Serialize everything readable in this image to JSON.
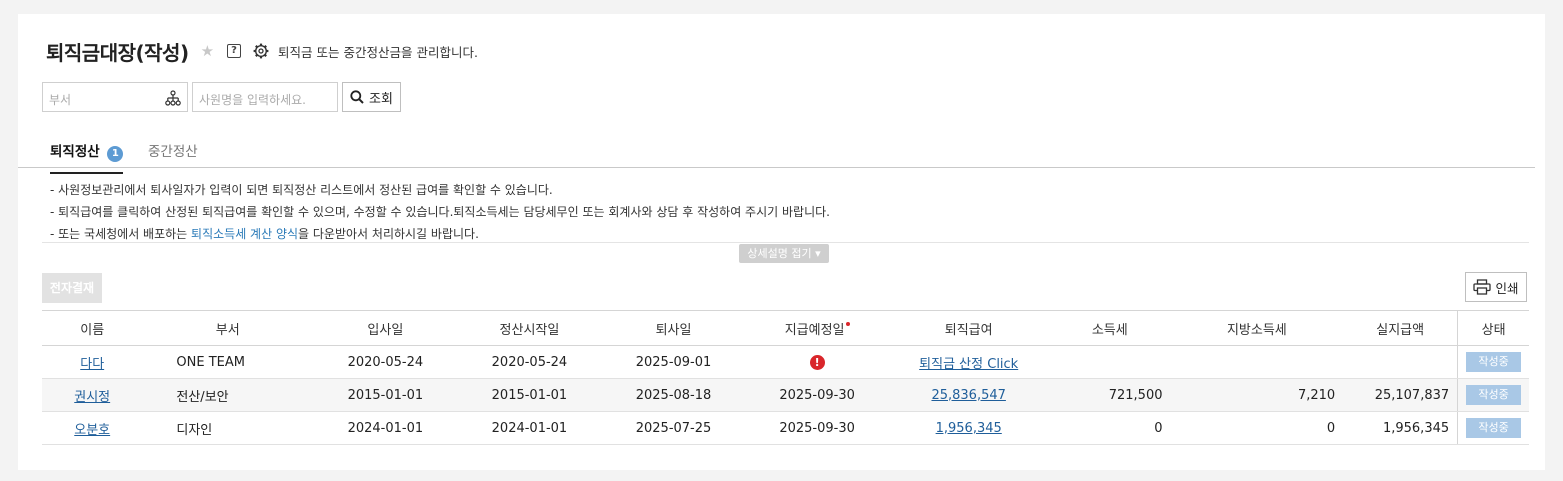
{
  "header": {
    "title": "퇴직금대장(작성)",
    "help_glyph": "?",
    "description": "퇴직금 또는 중간정산금을 관리합니다."
  },
  "search": {
    "dept_placeholder": "부서",
    "name_placeholder": "사원명을 입력하세요.",
    "button_label": "조회"
  },
  "tabs": [
    {
      "label": "퇴직정산",
      "badge": "1",
      "active": true
    },
    {
      "label": "중간정산",
      "active": false
    }
  ],
  "notes": {
    "line1": "- 사원정보관리에서 퇴사일자가 입력이 되면 퇴직정산 리스트에서 정산된 급여를 확인할 수 있습니다.",
    "line2": "- 퇴직급여를 클릭하여 산정된 퇴직급여를 확인할 수 있으며, 수정할 수 있습니다.퇴직소득세는 담당세무인 또는 회계사와 상담 후 작성하여 주시기 바랍니다.",
    "line3_prefix": "- 또는 국세청에서 배포하는 ",
    "line3_link": "퇴직소득세 계산 양식",
    "line3_suffix": "을 다운받아서 처리하시길 바랍니다.",
    "collapse_label": "상세설명 접기 ▾"
  },
  "toolbar": {
    "esign_label": "전자결재",
    "print_label": "인쇄"
  },
  "table": {
    "headers": [
      "이름",
      "부서",
      "입사일",
      "정산시작일",
      "퇴사일",
      "지급예정일",
      "퇴직급여",
      "소득세",
      "지방소득세",
      "실지급액",
      "상태"
    ],
    "rows": [
      {
        "name": "다다",
        "dept": "ONE TEAM",
        "hire_date": "2020-05-24",
        "start_date": "2020-05-24",
        "retire_date": "2025-09-01",
        "pay_date": "!",
        "severance": "퇴직금 산정 Click",
        "income_tax": "",
        "local_tax": "",
        "net_pay": "",
        "status": "작성중"
      },
      {
        "name": "권시정",
        "dept": "전산/보안",
        "hire_date": "2015-01-01",
        "start_date": "2015-01-01",
        "retire_date": "2025-08-18",
        "pay_date": "2025-09-30",
        "severance": "25,836,547",
        "income_tax": "721,500",
        "local_tax": "7,210",
        "net_pay": "25,107,837",
        "status": "작성중"
      },
      {
        "name": "오분호",
        "dept": "디자인",
        "hire_date": "2024-01-01",
        "start_date": "2024-01-01",
        "retire_date": "2025-07-25",
        "pay_date": "2025-09-30",
        "severance": "1,956,345",
        "income_tax": "0",
        "local_tax": "0",
        "net_pay": "1,956,345",
        "status": "작성중"
      }
    ]
  },
  "colors": {
    "accent_blue": "#5d9bd3",
    "link_blue": "#1f5e9a",
    "alert_red": "#d9262b",
    "status_badge": "#a9c8e6"
  },
  "icons": [
    "star-icon",
    "help-icon",
    "gear-icon",
    "org-chart-icon",
    "search-icon",
    "printer-icon",
    "alert-icon"
  ]
}
